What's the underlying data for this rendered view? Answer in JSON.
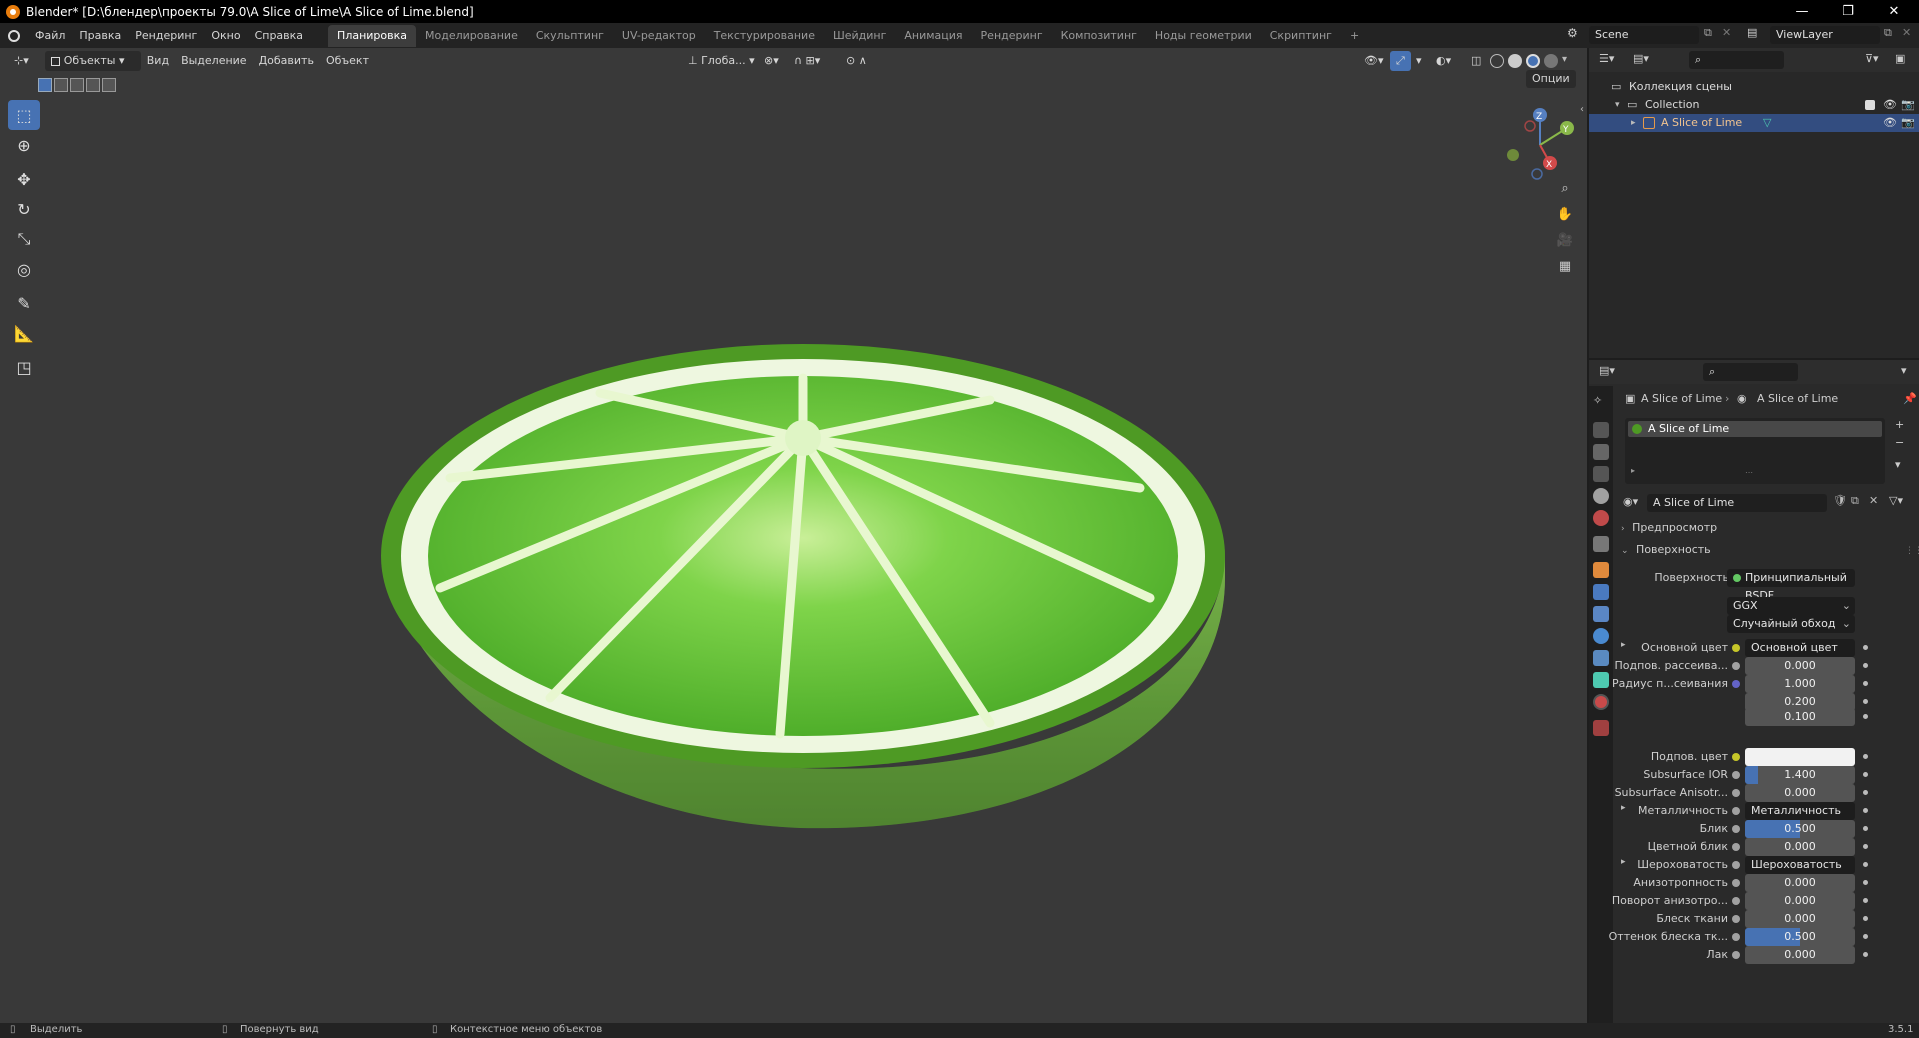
{
  "window": {
    "title": "Blender* [D:\\блендер\\проекты 79.0\\A Slice of Lime\\A Slice of Lime.blend]",
    "minimize": "—",
    "maximize": "❐",
    "close": "✕"
  },
  "menu": [
    "Файл",
    "Правка",
    "Рендеринг",
    "Окно",
    "Справка"
  ],
  "workspaces": [
    "Планировка",
    "Моделирование",
    "Скульптинг",
    "UV-редактор",
    "Текстурирование",
    "Шейдинг",
    "Анимация",
    "Рендеринг",
    "Композитинг",
    "Ноды геометрии",
    "Скриптинг",
    "+"
  ],
  "scene": {
    "name": "Scene",
    "view_layer": "ViewLayer"
  },
  "viewport_header": {
    "mode": "Объекты",
    "menus": [
      "Вид",
      "Выделение",
      "Добавить",
      "Объект"
    ],
    "orientation": "Глоба...",
    "options": "Опции"
  },
  "gizmo": {
    "x": "X",
    "y": "Y",
    "z": "Z"
  },
  "outliner": {
    "scene_collection": "Коллекция сцены",
    "collection": "Collection",
    "object": "A Slice of Lime"
  },
  "properties": {
    "breadcrumb_object": "A Slice of Lime",
    "breadcrumb_material": "A Slice of Lime",
    "slot_name": "A Slice of Lime",
    "material_name": "A Slice of Lime",
    "panel_preview": "Предпросмотр",
    "panel_surface": "Поверхность",
    "surface_label": "Поверхность",
    "surface_value": "Принципиальный BSDF",
    "distribution": "GGX",
    "subsurface_method": "Случайный обход",
    "rows": [
      {
        "label": "Основной цвет",
        "kind": "link",
        "value": "Основной цвет",
        "socket": "yellow",
        "expand": true
      },
      {
        "label": "Подпов. рассеива...",
        "kind": "num",
        "value": "0.000",
        "socket": "grey",
        "fill": 0
      },
      {
        "label": "Радиус п...сеивания",
        "kind": "num",
        "value": "1.000",
        "socket": "blue",
        "fill": 0
      },
      {
        "label": "",
        "kind": "num",
        "value": "0.200",
        "socket": "none",
        "fill": 0
      },
      {
        "label": "",
        "kind": "num",
        "value": "0.100",
        "socket": "none",
        "fill": 0
      },
      {
        "label": "Подпов. цвет",
        "kind": "color",
        "value": "",
        "socket": "yellow",
        "color": "#f2f2f2"
      },
      {
        "label": "Subsurface IOR",
        "kind": "num",
        "value": "1.400",
        "socket": "grey",
        "fill": 0.12
      },
      {
        "label": "Subsurface Anisotr...",
        "kind": "num",
        "value": "0.000",
        "socket": "grey",
        "fill": 0
      },
      {
        "label": "Металличность",
        "kind": "link",
        "value": "Металличность",
        "socket": "grey",
        "expand": true
      },
      {
        "label": "Блик",
        "kind": "num",
        "value": "0.500",
        "socket": "grey",
        "fill": 0.5
      },
      {
        "label": "Цветной блик",
        "kind": "num",
        "value": "0.000",
        "socket": "grey",
        "fill": 0
      },
      {
        "label": "Шероховатость",
        "kind": "link",
        "value": "Шероховатость",
        "socket": "grey",
        "expand": true
      },
      {
        "label": "Анизотропность",
        "kind": "num",
        "value": "0.000",
        "socket": "grey",
        "fill": 0
      },
      {
        "label": "Поворот анизотро...",
        "kind": "num",
        "value": "0.000",
        "socket": "grey",
        "fill": 0
      },
      {
        "label": "Блеск ткани",
        "kind": "num",
        "value": "0.000",
        "socket": "grey",
        "fill": 0
      },
      {
        "label": "Оттенок блеска тк...",
        "kind": "num",
        "value": "0.500",
        "socket": "grey",
        "fill": 0.5
      },
      {
        "label": "Лак",
        "kind": "num",
        "value": "0.000",
        "socket": "grey",
        "fill": 0
      }
    ]
  },
  "statusbar": {
    "select": "Выделить",
    "rotate": "Повернуть вид",
    "context": "Контекстное меню объектов",
    "version": "3.5.1"
  },
  "colors": {
    "accent": "#4772b3",
    "viewport_bg": "#393939",
    "lime_flesh": "#6cc63a",
    "lime_rind": "#5aa12a"
  }
}
